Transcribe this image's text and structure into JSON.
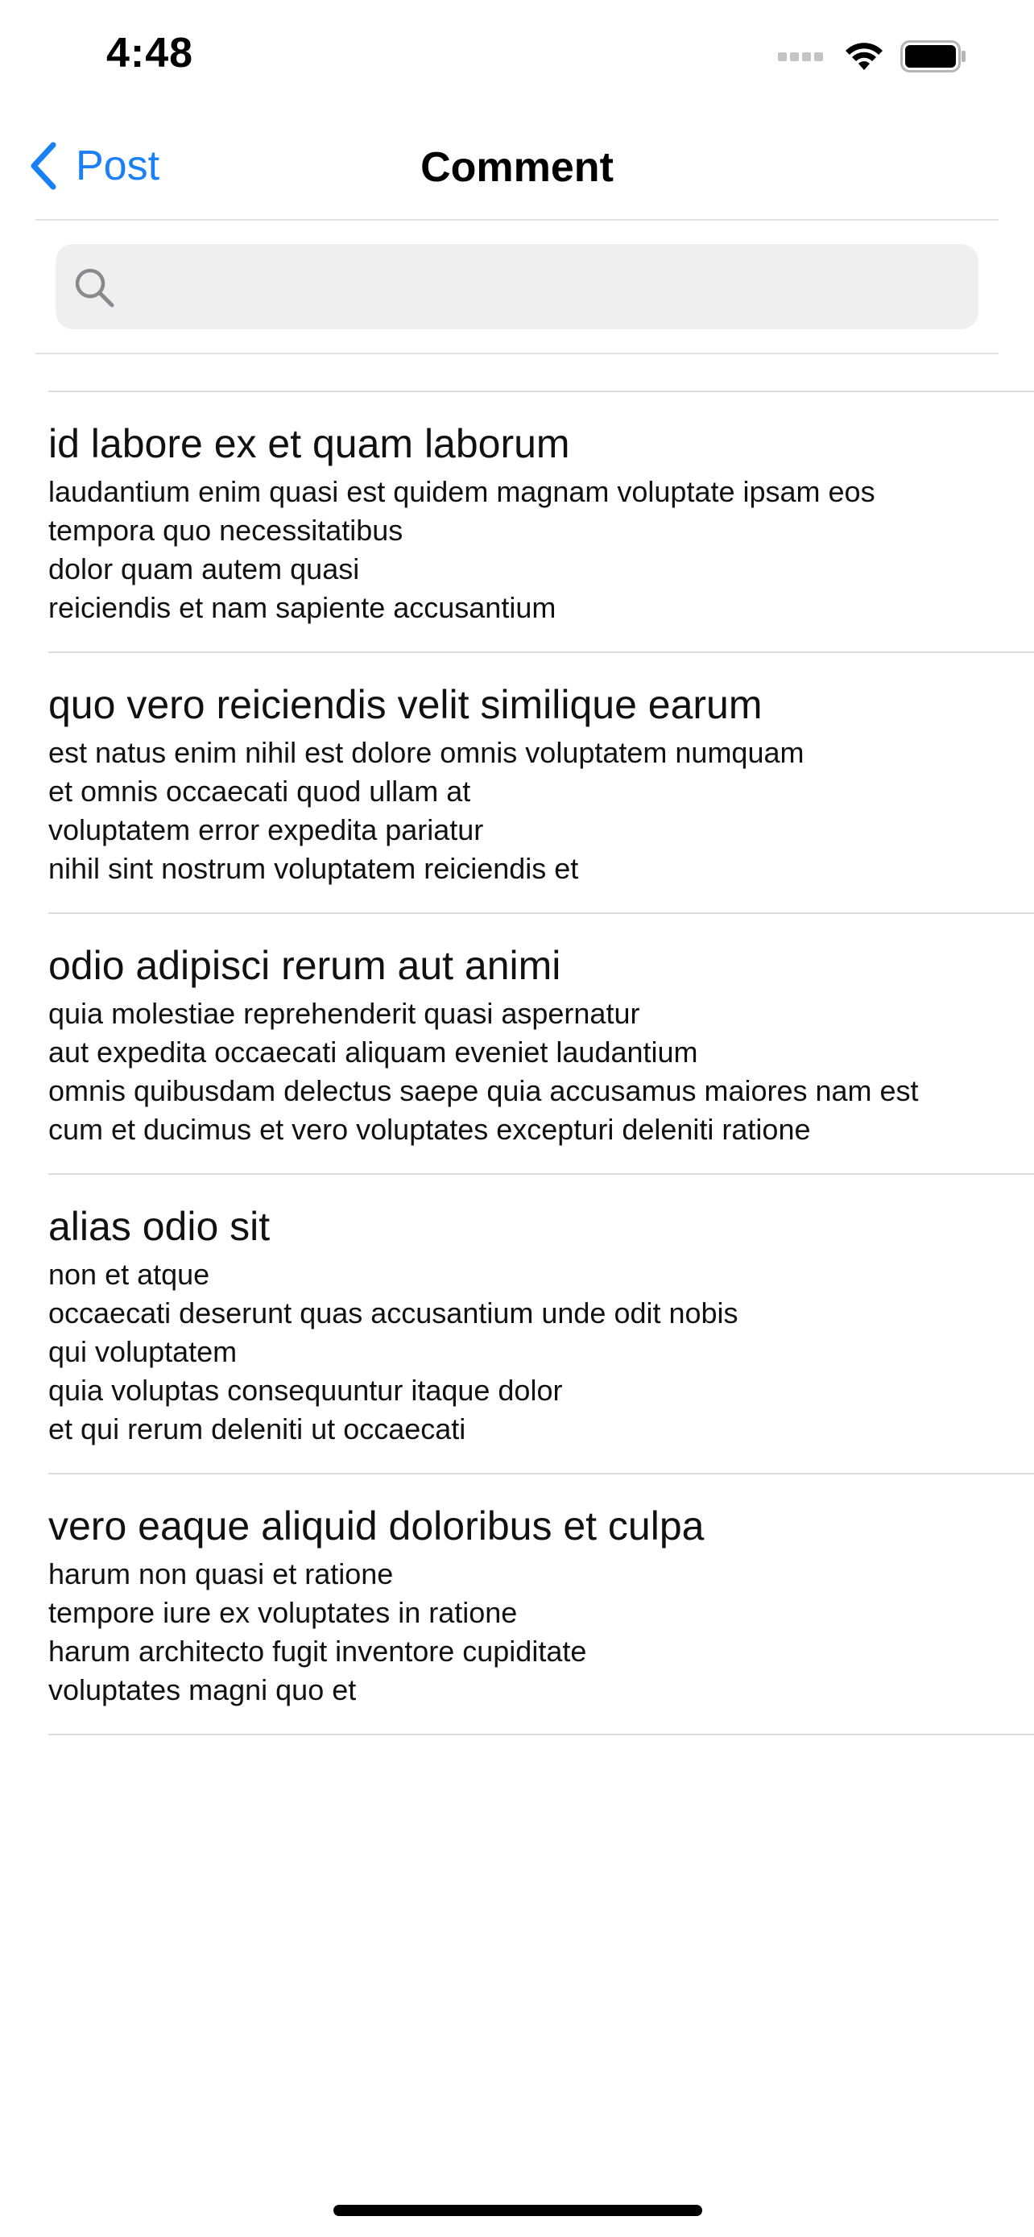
{
  "status_bar": {
    "time": "4:48"
  },
  "nav": {
    "back_label": "Post",
    "title": "Comment",
    "accent_color": "#1a80f5"
  },
  "search": {
    "placeholder": "",
    "value": ""
  },
  "comments": [
    {
      "title": "id labore ex et quam laborum",
      "lines": [
        "laudantium enim quasi est quidem magnam voluptate ipsam eos",
        "tempora quo necessitatibus",
        "dolor quam autem quasi",
        "reiciendis et nam sapiente accusantium"
      ]
    },
    {
      "title": "quo vero reiciendis velit similique earum",
      "lines": [
        "est natus enim nihil est dolore omnis voluptatem numquam",
        "et omnis occaecati quod ullam at",
        "voluptatem error expedita pariatur",
        "nihil sint nostrum voluptatem reiciendis et"
      ]
    },
    {
      "title": "odio adipisci rerum aut animi",
      "lines": [
        "quia molestiae reprehenderit quasi aspernatur",
        "aut expedita occaecati aliquam eveniet laudantium",
        "omnis quibusdam delectus saepe quia accusamus maiores nam est",
        "cum et ducimus et vero voluptates excepturi deleniti ratione"
      ]
    },
    {
      "title": "alias odio sit",
      "lines": [
        "non et atque",
        "occaecati deserunt quas accusantium unde odit nobis",
        "qui voluptatem",
        "quia voluptas consequuntur itaque dolor",
        "et qui rerum deleniti ut occaecati"
      ]
    },
    {
      "title": "vero eaque aliquid doloribus et culpa",
      "lines": [
        "harum non quasi et ratione",
        "tempore iure ex voluptates in ratione",
        "harum architecto fugit inventore cupiditate",
        "voluptates magni quo et"
      ]
    }
  ]
}
